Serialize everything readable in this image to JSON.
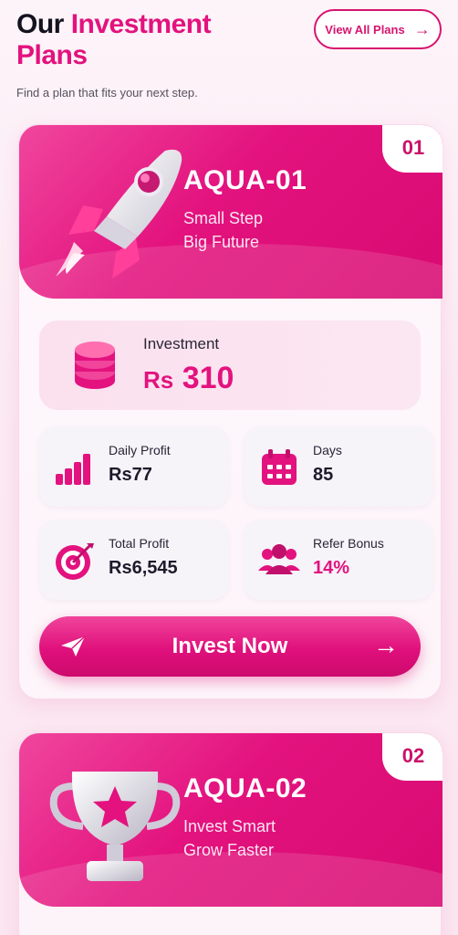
{
  "header": {
    "title_part1": "Our",
    "title_part2": "Investment",
    "title_part3": "Plans",
    "subtitle": "Find a plan that fits your next step.",
    "view_all_label": "View All Plans"
  },
  "colors": {
    "accent": "#e3127e",
    "background": "#fbeaf3"
  },
  "plans": [
    {
      "number": "01",
      "name": "AQUA-01",
      "tagline1": "Small Step",
      "tagline2": "Big Future",
      "icon": "rocket-icon",
      "investment_label": "Investment",
      "investment_currency": "Rs",
      "investment_value": "310",
      "stats": [
        {
          "label": "Daily Profit",
          "value": "Rs77",
          "icon": "bar-chart-icon"
        },
        {
          "label": "Days",
          "value": "85",
          "icon": "calendar-icon"
        },
        {
          "label": "Total Profit",
          "value": "Rs6,545",
          "icon": "target-icon"
        },
        {
          "label": "Refer Bonus",
          "value": "14%",
          "icon": "users-icon"
        }
      ],
      "cta_label": "Invest Now"
    },
    {
      "number": "02",
      "name": "AQUA-02",
      "tagline1": "Invest Smart",
      "tagline2": "Grow Faster",
      "icon": "trophy-icon"
    }
  ]
}
